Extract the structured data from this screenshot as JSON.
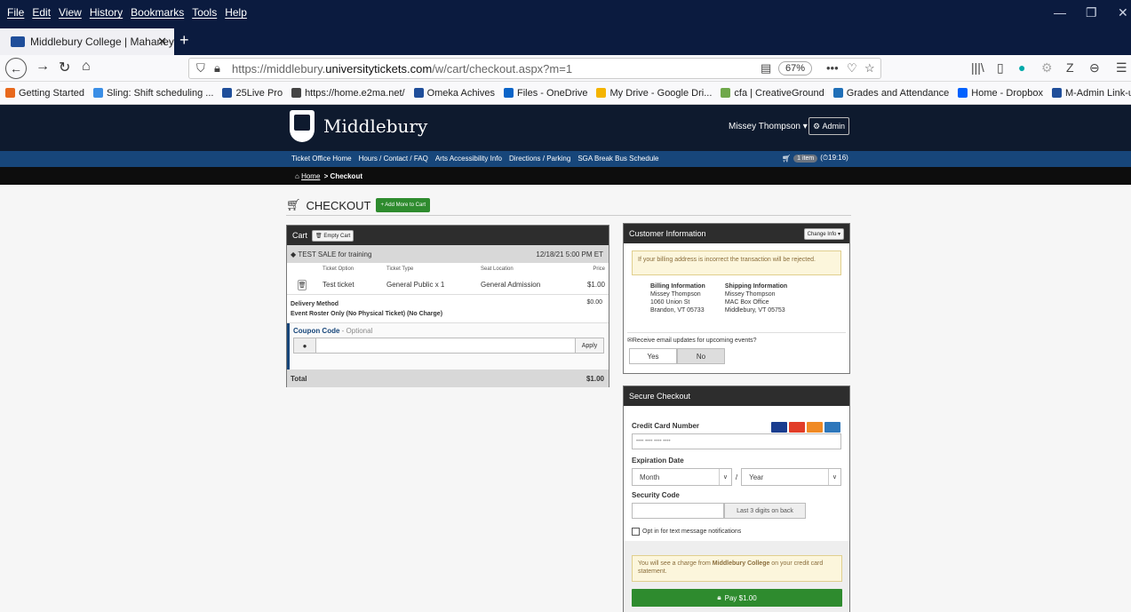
{
  "browser": {
    "menus": [
      "File",
      "Edit",
      "View",
      "History",
      "Bookmarks",
      "Tools",
      "Help"
    ],
    "tab_title": "Middlebury College | Mahaney",
    "url_prefix": "https://middlebury.",
    "url_domain": "universitytickets.com",
    "url_path": "/w/cart/checkout.aspx?m=1",
    "zoom": "67%",
    "bookmarks": [
      {
        "label": "Getting Started",
        "color": "#e8691d"
      },
      {
        "label": "Sling: Shift scheduling ...",
        "color": "#3a8ee6"
      },
      {
        "label": "25Live Pro",
        "color": "#1f4e9a"
      },
      {
        "label": "https://home.e2ma.net/",
        "color": "#444444"
      },
      {
        "label": "Omeka Achives",
        "color": "#1f4e9a"
      },
      {
        "label": "Files - OneDrive",
        "color": "#0a64c8"
      },
      {
        "label": "My Drive - Google Dri...",
        "color": "#f4b400"
      },
      {
        "label": "cfa | CreativeGround",
        "color": "#6fa84a"
      },
      {
        "label": "Grades and Attendance",
        "color": "#1f6fb8"
      },
      {
        "label": "Home - Dropbox",
        "color": "#0061fe"
      },
      {
        "label": "M-Admin Link-updates",
        "color": "#1f4e9a"
      }
    ]
  },
  "site": {
    "logo_text": "Middlebury",
    "user": "Missey Thompson ▾",
    "admin": "Admin",
    "nav": [
      "Ticket Office Home",
      "Hours / Contact / FAQ",
      "Arts Accessibility Info",
      "Directions / Parking",
      "SGA Break Bus Schedule"
    ],
    "cart_count": "1 item",
    "cart_timer": "(⏱19:16)",
    "crumb_home": "Home",
    "crumb_current": " > Checkout"
  },
  "checkout": {
    "title": "CHECKOUT",
    "add_more": "+ Add More to Cart"
  },
  "cart": {
    "label": "Cart",
    "empty_btn": "Empty Cart",
    "event": "TEST SALE for training",
    "event_date": "12/18/21 5:00 PM ET",
    "columns": [
      "Ticket Option",
      "Ticket Type",
      "Seat Location",
      "Price"
    ],
    "row": {
      "option": "Test ticket",
      "type": "General Public x 1",
      "seat": "General Admission",
      "price": "$1.00"
    },
    "delivery_title": "Delivery Method",
    "delivery_desc": "Event Roster Only (No Physical Ticket) (No Charge)",
    "delivery_price": "$0.00",
    "coupon_label": "Coupon Code",
    "coupon_optional": " - Optional",
    "apply": "Apply",
    "total_label": "Total",
    "total": "$1.00"
  },
  "customer": {
    "title": "Customer Information",
    "change": "Change Info ▾",
    "warning": "If your billing address is incorrect the transaction will be rejected.",
    "billing_title": "Billing Information",
    "billing": [
      "Missey Thompson",
      "1060 Union St",
      "Brandon, VT 05733"
    ],
    "shipping_title": "Shipping Information",
    "shipping": [
      "Missey Thompson",
      "MAC Box Office",
      "Middlebury, VT 05753"
    ],
    "email_q": "Receive email updates for upcoming events?",
    "yes": "Yes",
    "no": "No"
  },
  "secure": {
    "title": "Secure Checkout",
    "cc_label": "Credit Card Number",
    "cc_placeholder": "•••• •••• •••• ••••",
    "exp_label": "Expiration Date",
    "month": "Month",
    "year": "Year",
    "slash": "/",
    "sec_label": "Security Code",
    "sec_hint": "Last 3 digits on back",
    "optin": "Opt in for text message notifications",
    "charge_pre": "You will see a charge from ",
    "charge_org": "Middlebury College",
    "charge_post": " on your credit card statement.",
    "pay": "Pay $1.00",
    "card_colors": [
      "#1a3d8f",
      "#e23d28",
      "#f08a24",
      "#2e77bb"
    ]
  }
}
